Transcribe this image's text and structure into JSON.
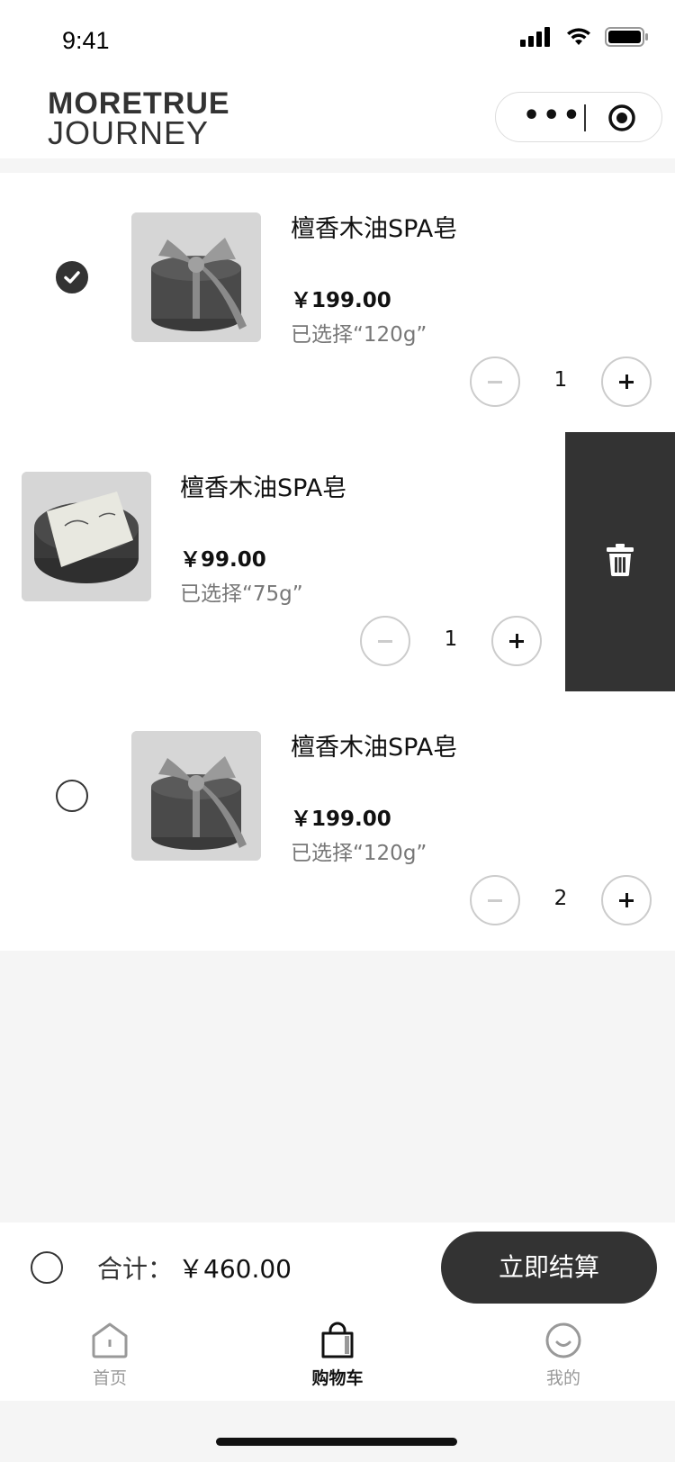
{
  "status_bar": {
    "time": "9:41"
  },
  "header": {
    "logo_line1": "MORETRUE",
    "logo_line2": "JOURNEY"
  },
  "cart": {
    "items": [
      {
        "name": "檀香木油SPA皂",
        "price": "￥199.00",
        "spec": "已选择“120g”",
        "quantity": "1",
        "selected": true
      },
      {
        "name": "檀香木油SPA皂",
        "price": "￥99.00",
        "spec": "已选择“75g”",
        "quantity": "1",
        "selected": false,
        "swiped": true
      },
      {
        "name": "檀香木油SPA皂",
        "price": "￥199.00",
        "spec": "已选择“120g”",
        "quantity": "2",
        "selected": false
      }
    ],
    "delete_icon": "trash-icon"
  },
  "summary": {
    "total_label": "合计：",
    "total_value": "￥460.00",
    "checkout_label": "立即结算"
  },
  "tabbar": {
    "tabs": [
      {
        "label": "首页",
        "icon": "home-icon",
        "active": false
      },
      {
        "label": "购物车",
        "icon": "bag-icon",
        "active": true
      },
      {
        "label": "我的",
        "icon": "smile-icon",
        "active": false
      }
    ]
  },
  "colors": {
    "accent": "#333333",
    "muted": "#999999",
    "background": "#f5f5f5"
  }
}
